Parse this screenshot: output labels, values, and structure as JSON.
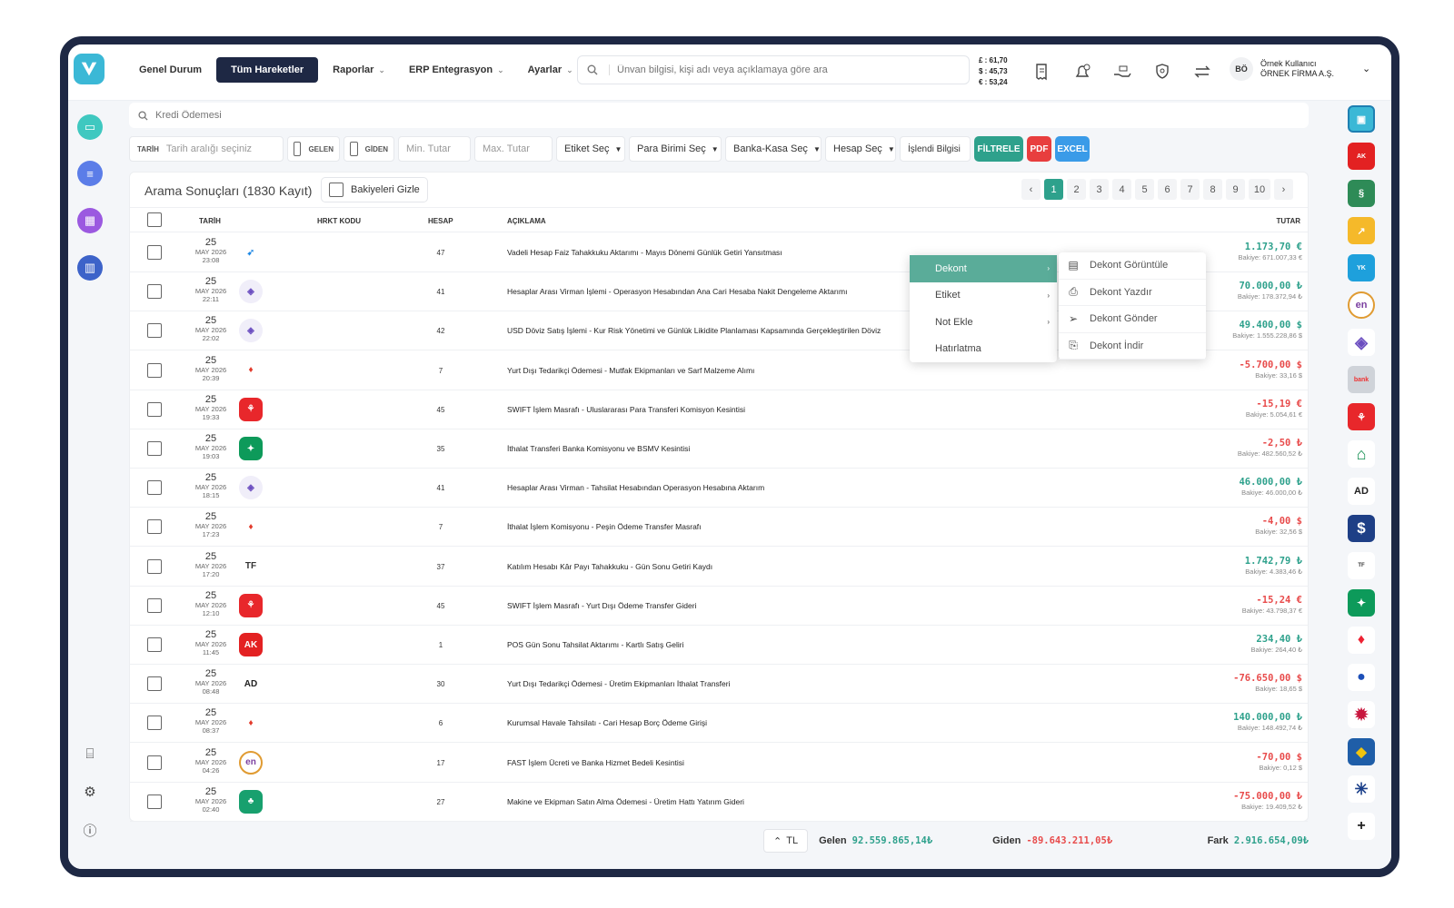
{
  "nav": {
    "items": [
      {
        "label": "Genel Durum",
        "active": false,
        "dropdown": false
      },
      {
        "label": "Tüm Hareketler",
        "active": true,
        "dropdown": false
      },
      {
        "label": "Raporlar",
        "active": false,
        "dropdown": true
      },
      {
        "label": "ERP Entegrasyon",
        "active": false,
        "dropdown": true
      },
      {
        "label": "Ayarlar",
        "active": false,
        "dropdown": true
      }
    ],
    "search_placeholder": "Ünvan bilgisi, kişi adı veya açıklamaya göre ara",
    "rates": [
      "£ : 61,70",
      "$ : 45,73",
      "€ : 53,24"
    ]
  },
  "user": {
    "initials": "BÖ",
    "name": "Örnek Kullanıcı",
    "company": "ÖRNEK FİRMA A.Ş."
  },
  "quick_search": {
    "placeholder": "Kredi Ödemesi"
  },
  "filters": {
    "date_label": "TARİH",
    "date_placeholder": "Tarih aralığı seçiniz",
    "incoming": "GELEN",
    "outgoing": "GİDEN",
    "min": "Min. Tutar",
    "max": "Max. Tutar",
    "tag": "Etiket Seç",
    "currency": "Para Birimi Seç",
    "bank": "Banka-Kasa Seç",
    "account": "Hesap Seç",
    "processed": "İşlendi Bilgisi",
    "filter_btn": "FİLTRELE",
    "pdf_btn": "PDF",
    "excel_btn": "EXCEL"
  },
  "results": {
    "title": "Arama Sonuçları (1830 Kayıt)",
    "hide_balances": "Bakiyeleri Gizle",
    "pages": [
      "‹",
      "1",
      "2",
      "3",
      "4",
      "5",
      "6",
      "7",
      "8",
      "9",
      "10",
      "›"
    ],
    "current_page": "1"
  },
  "columns": {
    "date": "TARİH",
    "code": "HRKT KODU",
    "account": "HESAP",
    "desc": "AÇIKLAMA",
    "amount": "TUTAR"
  },
  "rows": [
    {
      "day": "25",
      "month": "MAY 2026",
      "time": "23:08",
      "bank": "sky",
      "account": "47",
      "desc": "Vadeli Hesap Faiz Tahakkuku Aktarımı - Mayıs Dönemi Günlük Getiri Yansıtması",
      "amount": "1.173,70 €",
      "balance": "Bakiye: 671.007,33 €",
      "dir": "pos"
    },
    {
      "day": "25",
      "month": "MAY 2026",
      "time": "22:11",
      "bank": "diamond",
      "account": "41",
      "desc": "Hesaplar Arası Virman İşlemi - Operasyon Hesabından Ana Cari Hesaba Nakit Dengeleme Aktarımı",
      "amount": "70.000,00 ₺",
      "balance": "Bakiye: 178.372,94 ₺",
      "dir": "pos"
    },
    {
      "day": "25",
      "month": "MAY 2026",
      "time": "22:02",
      "bank": "diamond",
      "account": "42",
      "desc": "USD Döviz Satış İşlemi - Kur Risk Yönetimi ve Günlük Likidite Planlaması Kapsamında Gerçekleştirilen  Döviz",
      "amount": "49.400,00 $",
      "balance": "Bakiye: 1.555.228,86 $",
      "dir": "pos"
    },
    {
      "day": "25",
      "month": "MAY 2026",
      "time": "20:39",
      "bank": "flame",
      "account": "7",
      "desc": "Yurt Dışı Tedarikçi Ödemesi - Mutfak Ekipmanları ve Sarf Malzeme Alımı",
      "amount": "-5.700,00 $",
      "balance": "Bakiye: 33,16 $",
      "dir": "neg"
    },
    {
      "day": "25",
      "month": "MAY 2026",
      "time": "19:33",
      "bank": "red",
      "account": "45",
      "desc": "SWIFT İşlem Masrafı - Uluslararası Para Transferi Komisyon Kesintisi",
      "amount": "-15,19 €",
      "balance": "Bakiye: 5.054,61 €",
      "dir": "neg"
    },
    {
      "day": "25",
      "month": "MAY 2026",
      "time": "19:03",
      "bank": "green",
      "account": "35",
      "desc": "İthalat Transferi Banka Komisyonu ve BSMV Kesintisi",
      "amount": "-2,50 ₺",
      "balance": "Bakiye: 482.560,52 ₺",
      "dir": "neg"
    },
    {
      "day": "25",
      "month": "MAY 2026",
      "time": "18:15",
      "bank": "diamond",
      "account": "41",
      "desc": "Hesaplar Arası Virman - Tahsilat Hesabından Operasyon Hesabına Aktarım",
      "amount": "46.000,00 ₺",
      "balance": "Bakiye: 46.000,00 ₺",
      "dir": "pos"
    },
    {
      "day": "25",
      "month": "MAY 2026",
      "time": "17:23",
      "bank": "flame",
      "account": "7",
      "desc": "İthalat İşlem Komisyonu - Peşin Ödeme Transfer Masrafı",
      "amount": "-4,00 $",
      "balance": "Bakiye: 32,56 $",
      "dir": "neg"
    },
    {
      "day": "25",
      "month": "MAY 2026",
      "time": "17:20",
      "bank": "tf",
      "account": "37",
      "desc": "Katılım Hesabı Kâr Payı Tahakkuku - Gün Sonu Getiri Kaydı",
      "amount": "1.742,79 ₺",
      "balance": "Bakiye: 4.383,46 ₺",
      "dir": "pos"
    },
    {
      "day": "25",
      "month": "MAY 2026",
      "time": "12:10",
      "bank": "red",
      "account": "45",
      "desc": "SWIFT İşlem Masrafı - Yurt Dışı Ödeme Transfer Gideri",
      "amount": "-15,24 €",
      "balance": "Bakiye: 43.798,37 €",
      "dir": "neg"
    },
    {
      "day": "25",
      "month": "MAY 2026",
      "time": "11:45",
      "bank": "akbank",
      "account": "1",
      "desc": "POS Gün Sonu Tahsilat Aktarımı - Kartlı Satış Geliri",
      "amount": "234,40 ₺",
      "balance": "Bakiye: 264,40 ₺",
      "dir": "pos"
    },
    {
      "day": "25",
      "month": "MAY 2026",
      "time": "08:48",
      "bank": "ad",
      "account": "30",
      "desc": "Yurt Dışı Tedarikçi Ödemesi - Üretim Ekipmanları İthalat Transferi",
      "amount": "-76.650,00 $",
      "balance": "Bakiye: 18,65 $",
      "dir": "neg"
    },
    {
      "day": "25",
      "month": "MAY 2026",
      "time": "08:37",
      "bank": "flame",
      "account": "6",
      "desc": "Kurumsal Havale Tahsilatı - Cari Hesap Borç Ödeme Girişi",
      "amount": "140.000,00 ₺",
      "balance": "Bakiye: 148.492,74 ₺",
      "dir": "pos"
    },
    {
      "day": "25",
      "month": "MAY 2026",
      "time": "04:26",
      "bank": "en",
      "account": "17",
      "desc": "FAST İşlem Ücreti ve Banka Hizmet Bedeli Kesintisi",
      "amount": "-70,00 $",
      "balance": "Bakiye: 0,12 $",
      "dir": "neg"
    },
    {
      "day": "25",
      "month": "MAY 2026",
      "time": "02:40",
      "bank": "tree",
      "account": "27",
      "desc": "Makine ve Ekipman Satın Alma Ödemesi - Üretim Hattı Yatırım Gideri",
      "amount": "-75.000,00 ₺",
      "balance": "Bakiye: 19.409,52 ₺",
      "dir": "neg"
    }
  ],
  "context_menu": [
    {
      "label": "Dekont",
      "submenu": true,
      "active": true
    },
    {
      "label": "Etiket",
      "submenu": true,
      "active": false
    },
    {
      "label": "Not Ekle",
      "submenu": true,
      "active": false
    },
    {
      "label": "Hatırlatma",
      "submenu": false,
      "active": false
    }
  ],
  "submenu": [
    {
      "icon": "document-icon",
      "label": "Dekont Görüntüle"
    },
    {
      "icon": "printer-icon",
      "label": "Dekont Yazdır"
    },
    {
      "icon": "send-icon",
      "label": "Dekont Gönder"
    },
    {
      "icon": "pdf-download-icon",
      "label": "Dekont İndir"
    }
  ],
  "footer": {
    "currency": "TL",
    "in_label": "Gelen",
    "in_value": "92.559.865,14₺",
    "out_label": "Giden",
    "out_value": "-89.643.211,05₺",
    "diff_label": "Fark",
    "diff_value": "2.916.654,09₺"
  },
  "colors": {
    "accent": "#2ea18c",
    "navy": "#1e2844",
    "negative": "#e84b4b",
    "pdf": "#e83e3e",
    "excel": "#3a9be8"
  }
}
